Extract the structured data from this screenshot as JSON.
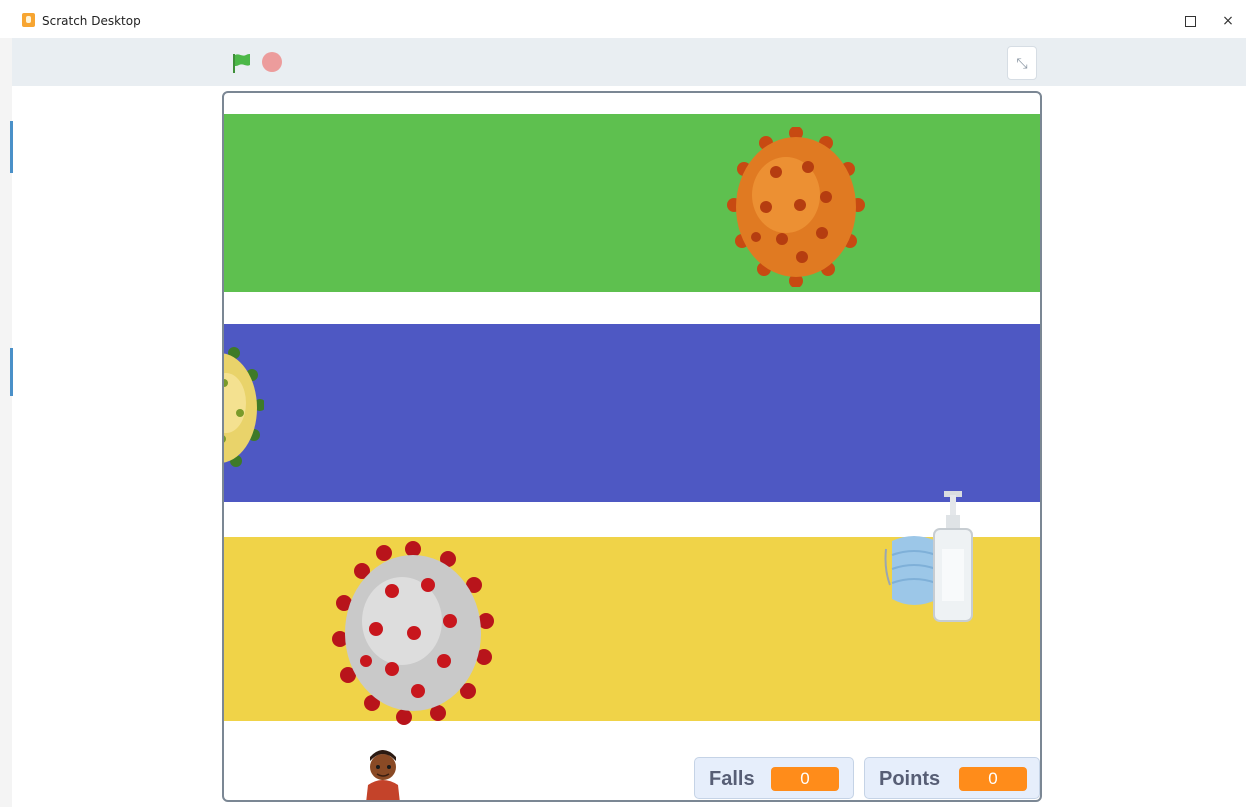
{
  "window": {
    "title": "Scratch Desktop",
    "maximize_icon": "maximize-icon",
    "close_icon": "close-icon",
    "close_glyph": "×"
  },
  "toolbar": {
    "green_flag_icon": "green-flag-icon",
    "stop_icon": "stop-icon",
    "fullscreen_icon": "fullscreen-exit-icon",
    "fullscreen_glyph": "⤡"
  },
  "stage": {
    "bands": [
      "green",
      "blue",
      "yellow"
    ],
    "colors": {
      "green": "#5ec04f",
      "blue": "#4e58c3",
      "yellow": "#f0d348",
      "accent": "#ff8c1a"
    },
    "sprites": [
      "virus-orange",
      "virus-green",
      "virus-red",
      "sanitizer-and-mask",
      "player-character"
    ]
  },
  "monitors": [
    {
      "label": "Falls",
      "value": "0"
    },
    {
      "label": "Points",
      "value": "0"
    }
  ]
}
